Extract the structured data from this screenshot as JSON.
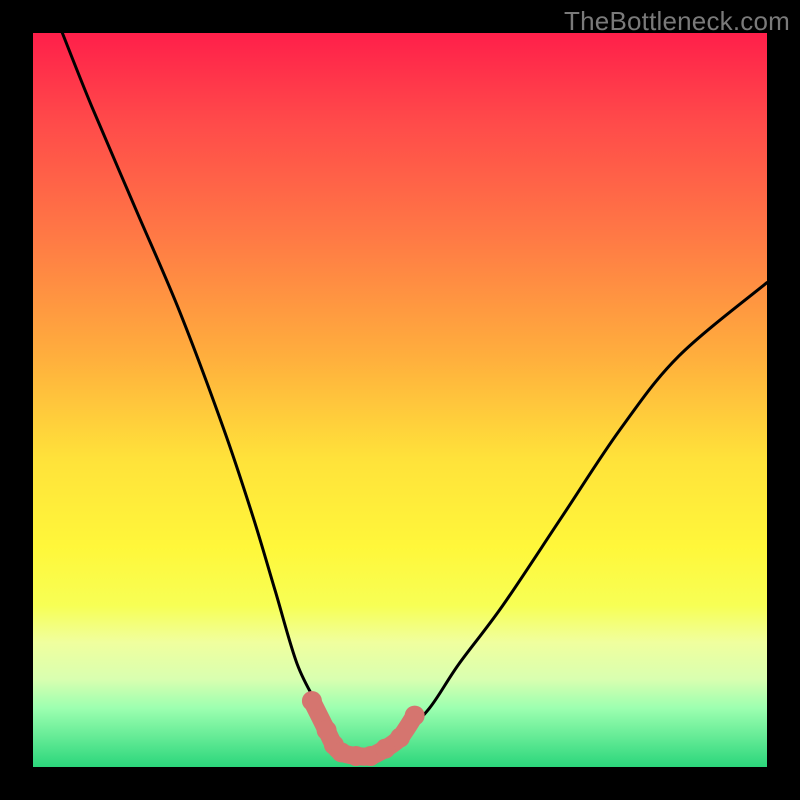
{
  "watermark": "TheBottleneck.com",
  "chart_data": {
    "type": "line",
    "title": "",
    "xlabel": "",
    "ylabel": "",
    "xlim": [
      0,
      100
    ],
    "ylim": [
      0,
      100
    ],
    "series": [
      {
        "name": "bottleneck-curve",
        "x": [
          4,
          8,
          14,
          20,
          26,
          30,
          33,
          36,
          39,
          41,
          43,
          45,
          47,
          50,
          54,
          58,
          64,
          72,
          80,
          88,
          100
        ],
        "y": [
          100,
          90,
          76,
          62,
          46,
          34,
          24,
          14,
          8,
          4,
          2,
          1,
          2,
          4,
          8,
          14,
          22,
          34,
          46,
          56,
          66
        ]
      }
    ],
    "highlight": {
      "name": "optimal-range",
      "color": "#d5756f",
      "points_x": [
        38,
        40,
        41,
        42,
        44,
        46,
        48,
        50,
        52
      ],
      "points_y": [
        9,
        5,
        3,
        2,
        1.5,
        1.5,
        2.5,
        4,
        7
      ]
    }
  },
  "colors": {
    "frame": "#000000",
    "curve": "#000000",
    "highlight": "#d5756f",
    "watermark": "#7a7a7a"
  }
}
